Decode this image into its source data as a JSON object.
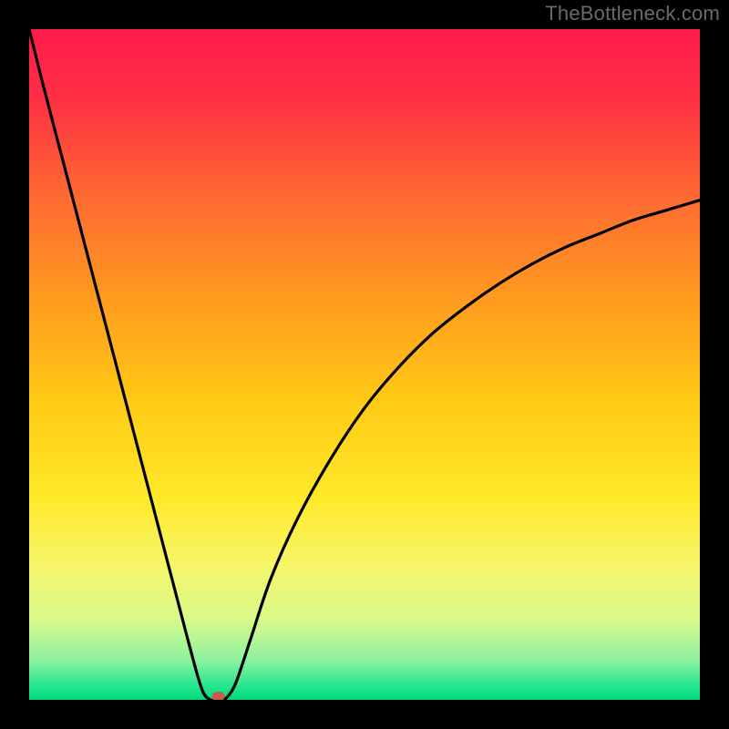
{
  "watermark": "TheBottleneck.com",
  "chart_data": {
    "type": "line",
    "title": "",
    "xlabel": "",
    "ylabel": "",
    "xlim": [
      0,
      100
    ],
    "ylim": [
      0,
      100
    ],
    "grid": false,
    "x": [
      0,
      2,
      5,
      8,
      11,
      14,
      17,
      20,
      23,
      25,
      26,
      27,
      28,
      29,
      30,
      31,
      33,
      36,
      40,
      45,
      50,
      55,
      60,
      65,
      70,
      75,
      80,
      85,
      90,
      95,
      100
    ],
    "values": [
      100,
      92,
      80.5,
      69,
      57.5,
      46,
      34.5,
      23,
      11.5,
      4,
      1,
      0,
      0,
      0,
      1,
      3,
      9,
      18,
      27,
      36,
      43.5,
      49.5,
      54.5,
      58.5,
      62,
      65,
      67.5,
      69.5,
      71.5,
      73,
      74.5
    ],
    "marker": {
      "x": 28.2,
      "y": 0.5
    },
    "background": {
      "type": "vertical-gradient",
      "stops": [
        {
          "offset": 0.0,
          "color": "#ff1a4b"
        },
        {
          "offset": 0.1,
          "color": "#ff2f45"
        },
        {
          "offset": 0.25,
          "color": "#ff6a32"
        },
        {
          "offset": 0.4,
          "color": "#ff9a1f"
        },
        {
          "offset": 0.55,
          "color": "#ffc915"
        },
        {
          "offset": 0.7,
          "color": "#ffe92a"
        },
        {
          "offset": 0.8,
          "color": "#f6f66a"
        },
        {
          "offset": 0.88,
          "color": "#d9f98a"
        },
        {
          "offset": 0.94,
          "color": "#8ef2a0"
        },
        {
          "offset": 0.985,
          "color": "#19e48b"
        },
        {
          "offset": 1.0,
          "color": "#00d97c"
        }
      ]
    }
  }
}
